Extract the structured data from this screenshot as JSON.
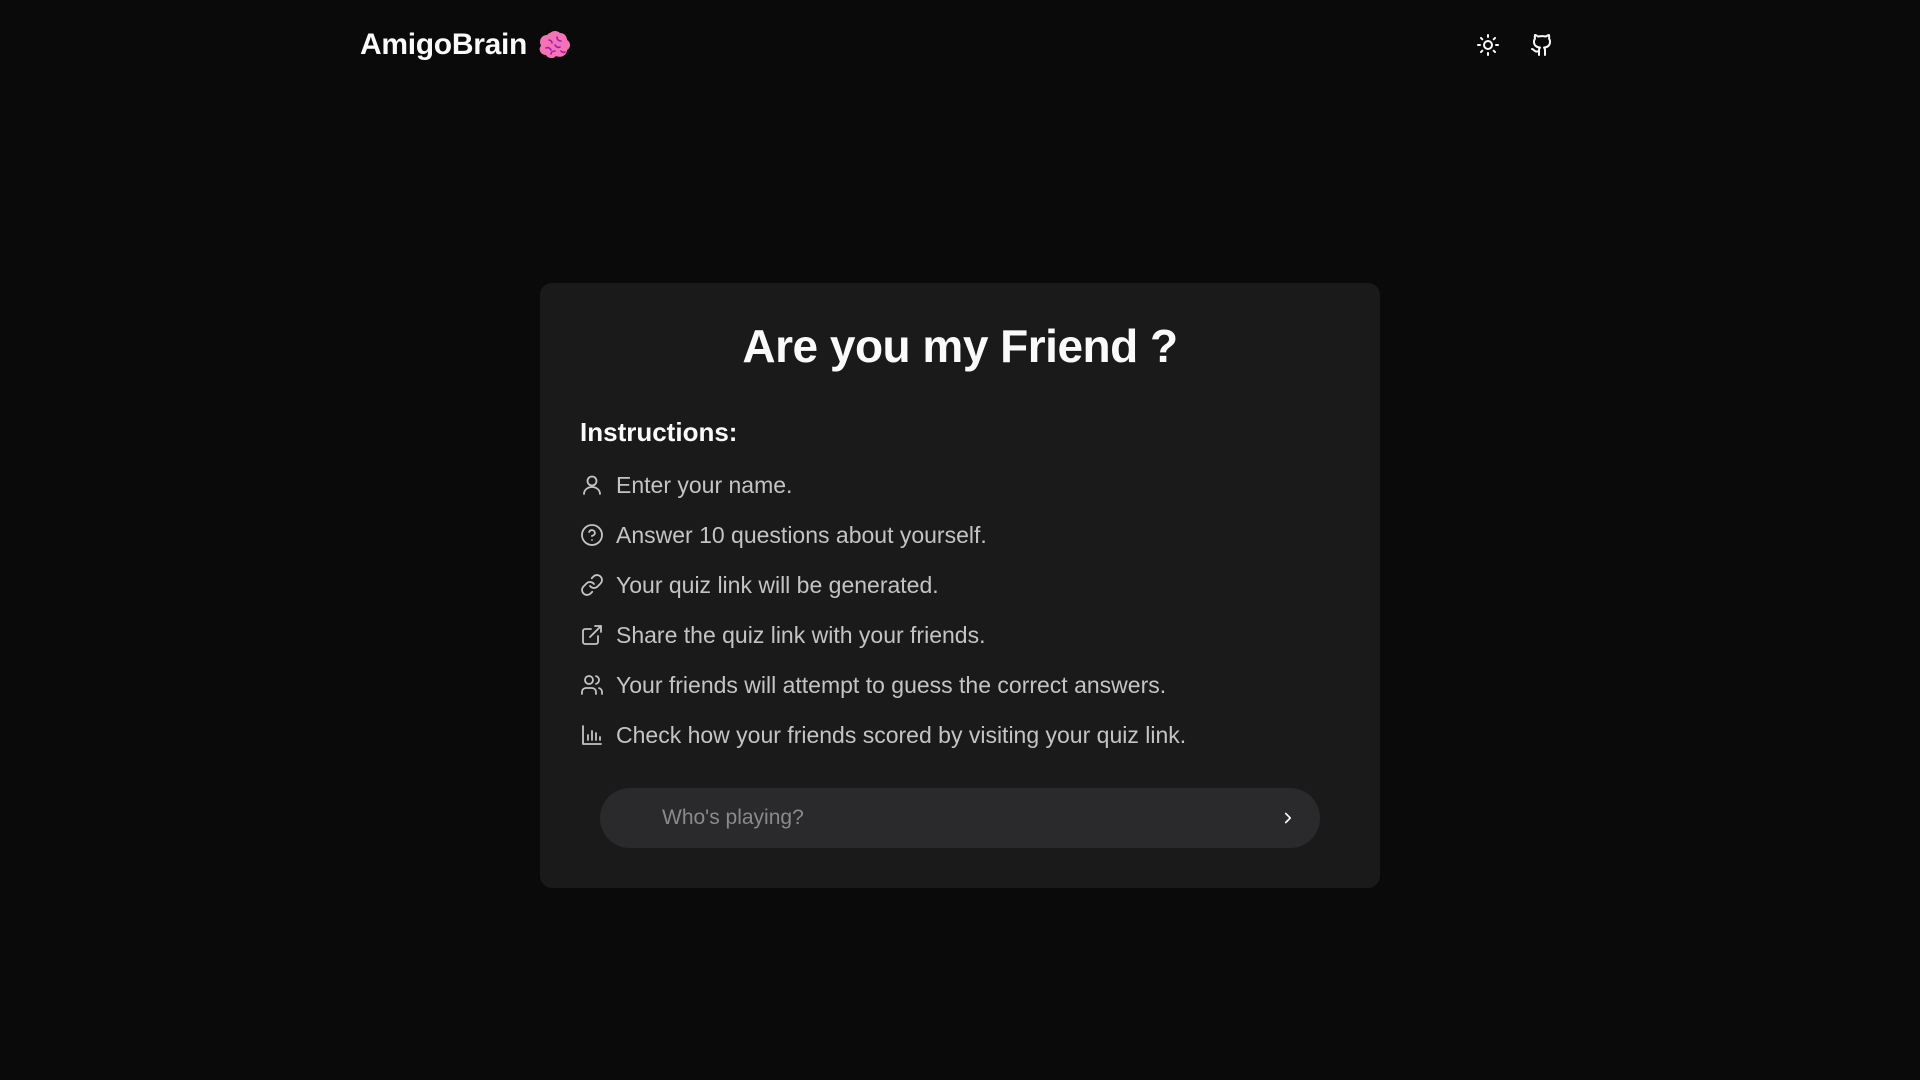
{
  "header": {
    "brand": "AmigoBrain",
    "brand_icon": "brain-icon",
    "theme_toggle_icon": "sun-icon",
    "github_icon": "github-icon"
  },
  "card": {
    "title": "Are you my Friend  ?",
    "instructions_heading": "Instructions:",
    "steps": [
      {
        "icon": "user-icon",
        "text": "Enter your name."
      },
      {
        "icon": "question-circle-icon",
        "text": "Answer 10 questions about yourself."
      },
      {
        "icon": "link-icon",
        "text": "Your quiz link will be generated."
      },
      {
        "icon": "external-link-icon",
        "text": "Share the quiz link with your friends."
      },
      {
        "icon": "users-icon",
        "text": "Your friends will attempt to guess the correct answers."
      },
      {
        "icon": "bar-chart-icon",
        "text": "Check how your friends scored by visiting your quiz link."
      }
    ],
    "name_input": {
      "placeholder": "Who's playing?",
      "value": ""
    },
    "submit_icon": "chevron-right-icon"
  },
  "colors": {
    "background": "#0a0a0a",
    "card": "#1a1a1a",
    "input": "#2a2a2c",
    "text": "#fafafa",
    "muted_text": "#c4c4c4",
    "brain_pink": "#f472b6"
  }
}
